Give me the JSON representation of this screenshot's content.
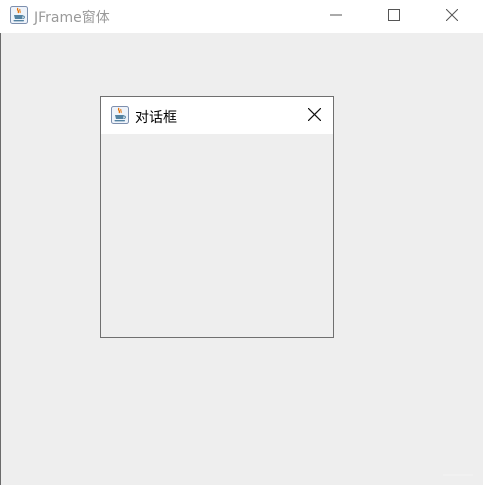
{
  "main_window": {
    "title": "JFrame窗体",
    "icon": "java-coffee-icon",
    "controls": [
      "minimize-icon",
      "maximize-icon",
      "close-icon"
    ]
  },
  "dialog": {
    "title": "对话框",
    "icon": "java-coffee-icon",
    "controls": [
      "close-icon"
    ]
  }
}
